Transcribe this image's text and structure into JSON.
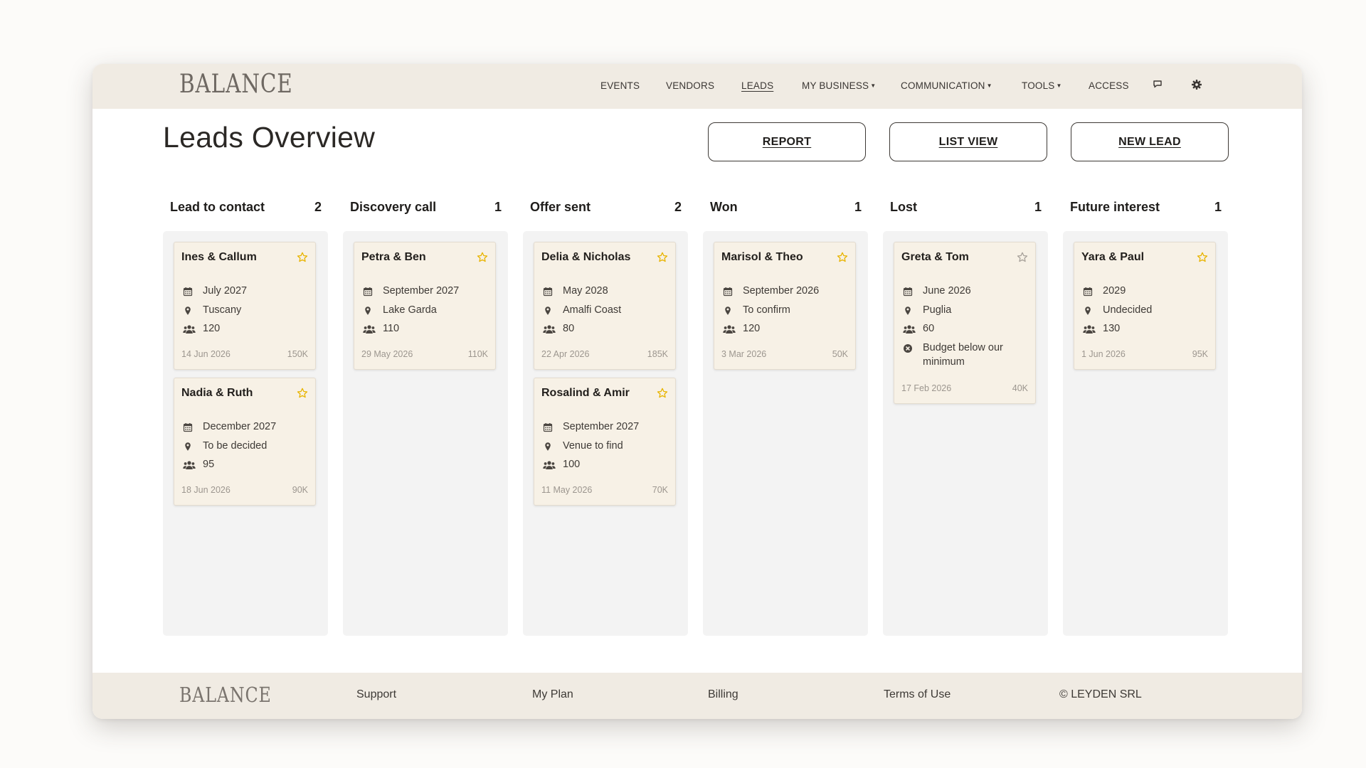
{
  "header": {
    "logo": "BALANCE",
    "nav": [
      {
        "label": "EVENTS"
      },
      {
        "label": "VENDORS"
      },
      {
        "label": "LEADS"
      },
      {
        "label": "MY BUSINESS"
      },
      {
        "label": "COMMUNICATION"
      },
      {
        "label": "TOOLS"
      },
      {
        "label": "ACCESS"
      }
    ],
    "icons": [
      "chat-icon",
      "gear-icon"
    ]
  },
  "page": {
    "title": "Leads Overview",
    "buttons": {
      "report": "REPORT",
      "list_view": "LIST VIEW",
      "new_lead": "NEW LEAD"
    }
  },
  "colors": {
    "accent_star": "#e8b400",
    "inactive_star": "#a8a29b",
    "header_bg": "#f0ebe3",
    "card_bg": "#f7f1e6"
  },
  "columns": [
    {
      "name": "Lead to contact",
      "count": "2",
      "cards": [
        {
          "name": "Ines & Callum",
          "starred": true,
          "month": "July 2027",
          "location": "Tuscany",
          "guests": "120",
          "date": "14 Jun 2026",
          "budget": "150K"
        },
        {
          "name": "Nadia & Ruth",
          "starred": true,
          "month": "December 2027",
          "location": "To be decided",
          "guests": "95",
          "date": "18 Jun 2026",
          "budget": "90K"
        }
      ]
    },
    {
      "name": "Discovery call",
      "count": "1",
      "cards": [
        {
          "name": "Petra & Ben",
          "starred": true,
          "month": "September 2027",
          "location": "Lake Garda",
          "guests": "110",
          "date": "29 May 2026",
          "budget": "110K"
        }
      ]
    },
    {
      "name": "Offer sent",
      "count": "2",
      "cards": [
        {
          "name": "Delia & Nicholas",
          "starred": true,
          "month": "May 2028",
          "location": "Amalfi Coast",
          "guests": "80",
          "date": "22 Apr 2026",
          "budget": "185K"
        },
        {
          "name": "Rosalind & Amir",
          "starred": true,
          "month": "September 2027",
          "location": "Venue to find",
          "guests": "100",
          "date": "11 May 2026",
          "budget": "70K"
        }
      ]
    },
    {
      "name": "Won",
      "count": "1",
      "cards": [
        {
          "name": "Marisol & Theo",
          "starred": true,
          "month": "September 2026",
          "location": "To confirm",
          "guests": "120",
          "date": "3 Mar 2026",
          "budget": "50K"
        }
      ]
    },
    {
      "name": "Lost",
      "count": "1",
      "cards": [
        {
          "name": "Greta & Tom",
          "starred": false,
          "month": "June 2026",
          "location": "Puglia",
          "guests": "60",
          "reason": "Budget below our minimum",
          "date": "17 Feb 2026",
          "budget": "40K"
        }
      ]
    },
    {
      "name": "Future interest",
      "count": "1",
      "cards": [
        {
          "name": "Yara & Paul",
          "starred": true,
          "month": "2029",
          "location": "Undecided",
          "guests": "130",
          "date": "1 Jun 2026",
          "budget": "95K"
        }
      ]
    }
  ],
  "footer": {
    "logo": "BALANCE",
    "links": [
      "Support",
      "My Plan",
      "Billing",
      "Terms of Use"
    ],
    "copyright": "© LEYDEN SRL"
  }
}
